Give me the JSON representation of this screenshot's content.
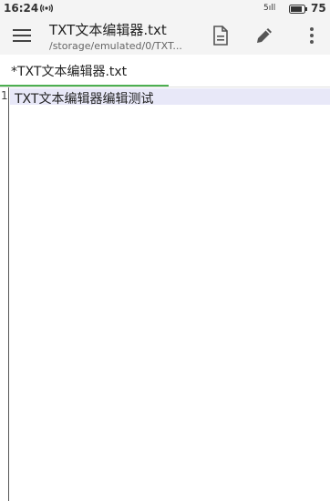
{
  "status_bar": {
    "time": "16:24",
    "signal": "5ıll",
    "battery": "75",
    "hotspot_icon": "hotspot-icon",
    "battery_icon": "battery-icon"
  },
  "app_bar": {
    "title": "TXT文本编辑器.txt",
    "subtitle": "/storage/emulated/0/TXT...",
    "menu_icon": "menu-icon",
    "doc_icon": "document-icon",
    "edit_icon": "pencil-icon",
    "more_icon": "more-vert-icon"
  },
  "tabs": [
    {
      "label": "*TXT文本编辑器.txt",
      "active": true
    }
  ],
  "editor": {
    "lines": [
      {
        "number": "1",
        "text": "TXT文本编辑器编辑测试"
      }
    ]
  },
  "colors": {
    "accent": "#4caf50",
    "current_line": "#e8e8f8",
    "bar_background": "#f4f4f4"
  }
}
